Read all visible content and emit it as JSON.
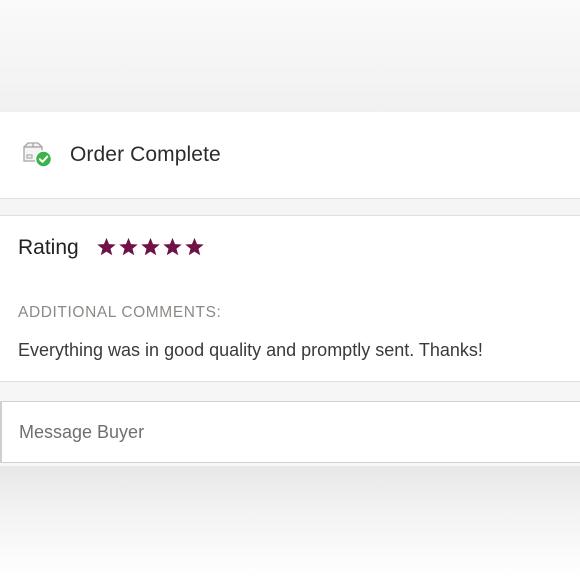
{
  "order": {
    "status_icon": "package-check-icon",
    "title": "Order Complete"
  },
  "rating": {
    "label": "Rating",
    "stars": 5,
    "max_stars": 5,
    "star_color": "#6f1247"
  },
  "comments": {
    "heading": "ADDITIONAL COMMENTS:",
    "text": "Everything was in good quality and promptly sent. Thanks!"
  },
  "message": {
    "placeholder": "Message Buyer"
  },
  "colors": {
    "success_green": "#3cb24b",
    "divider": "#e3dde0"
  }
}
